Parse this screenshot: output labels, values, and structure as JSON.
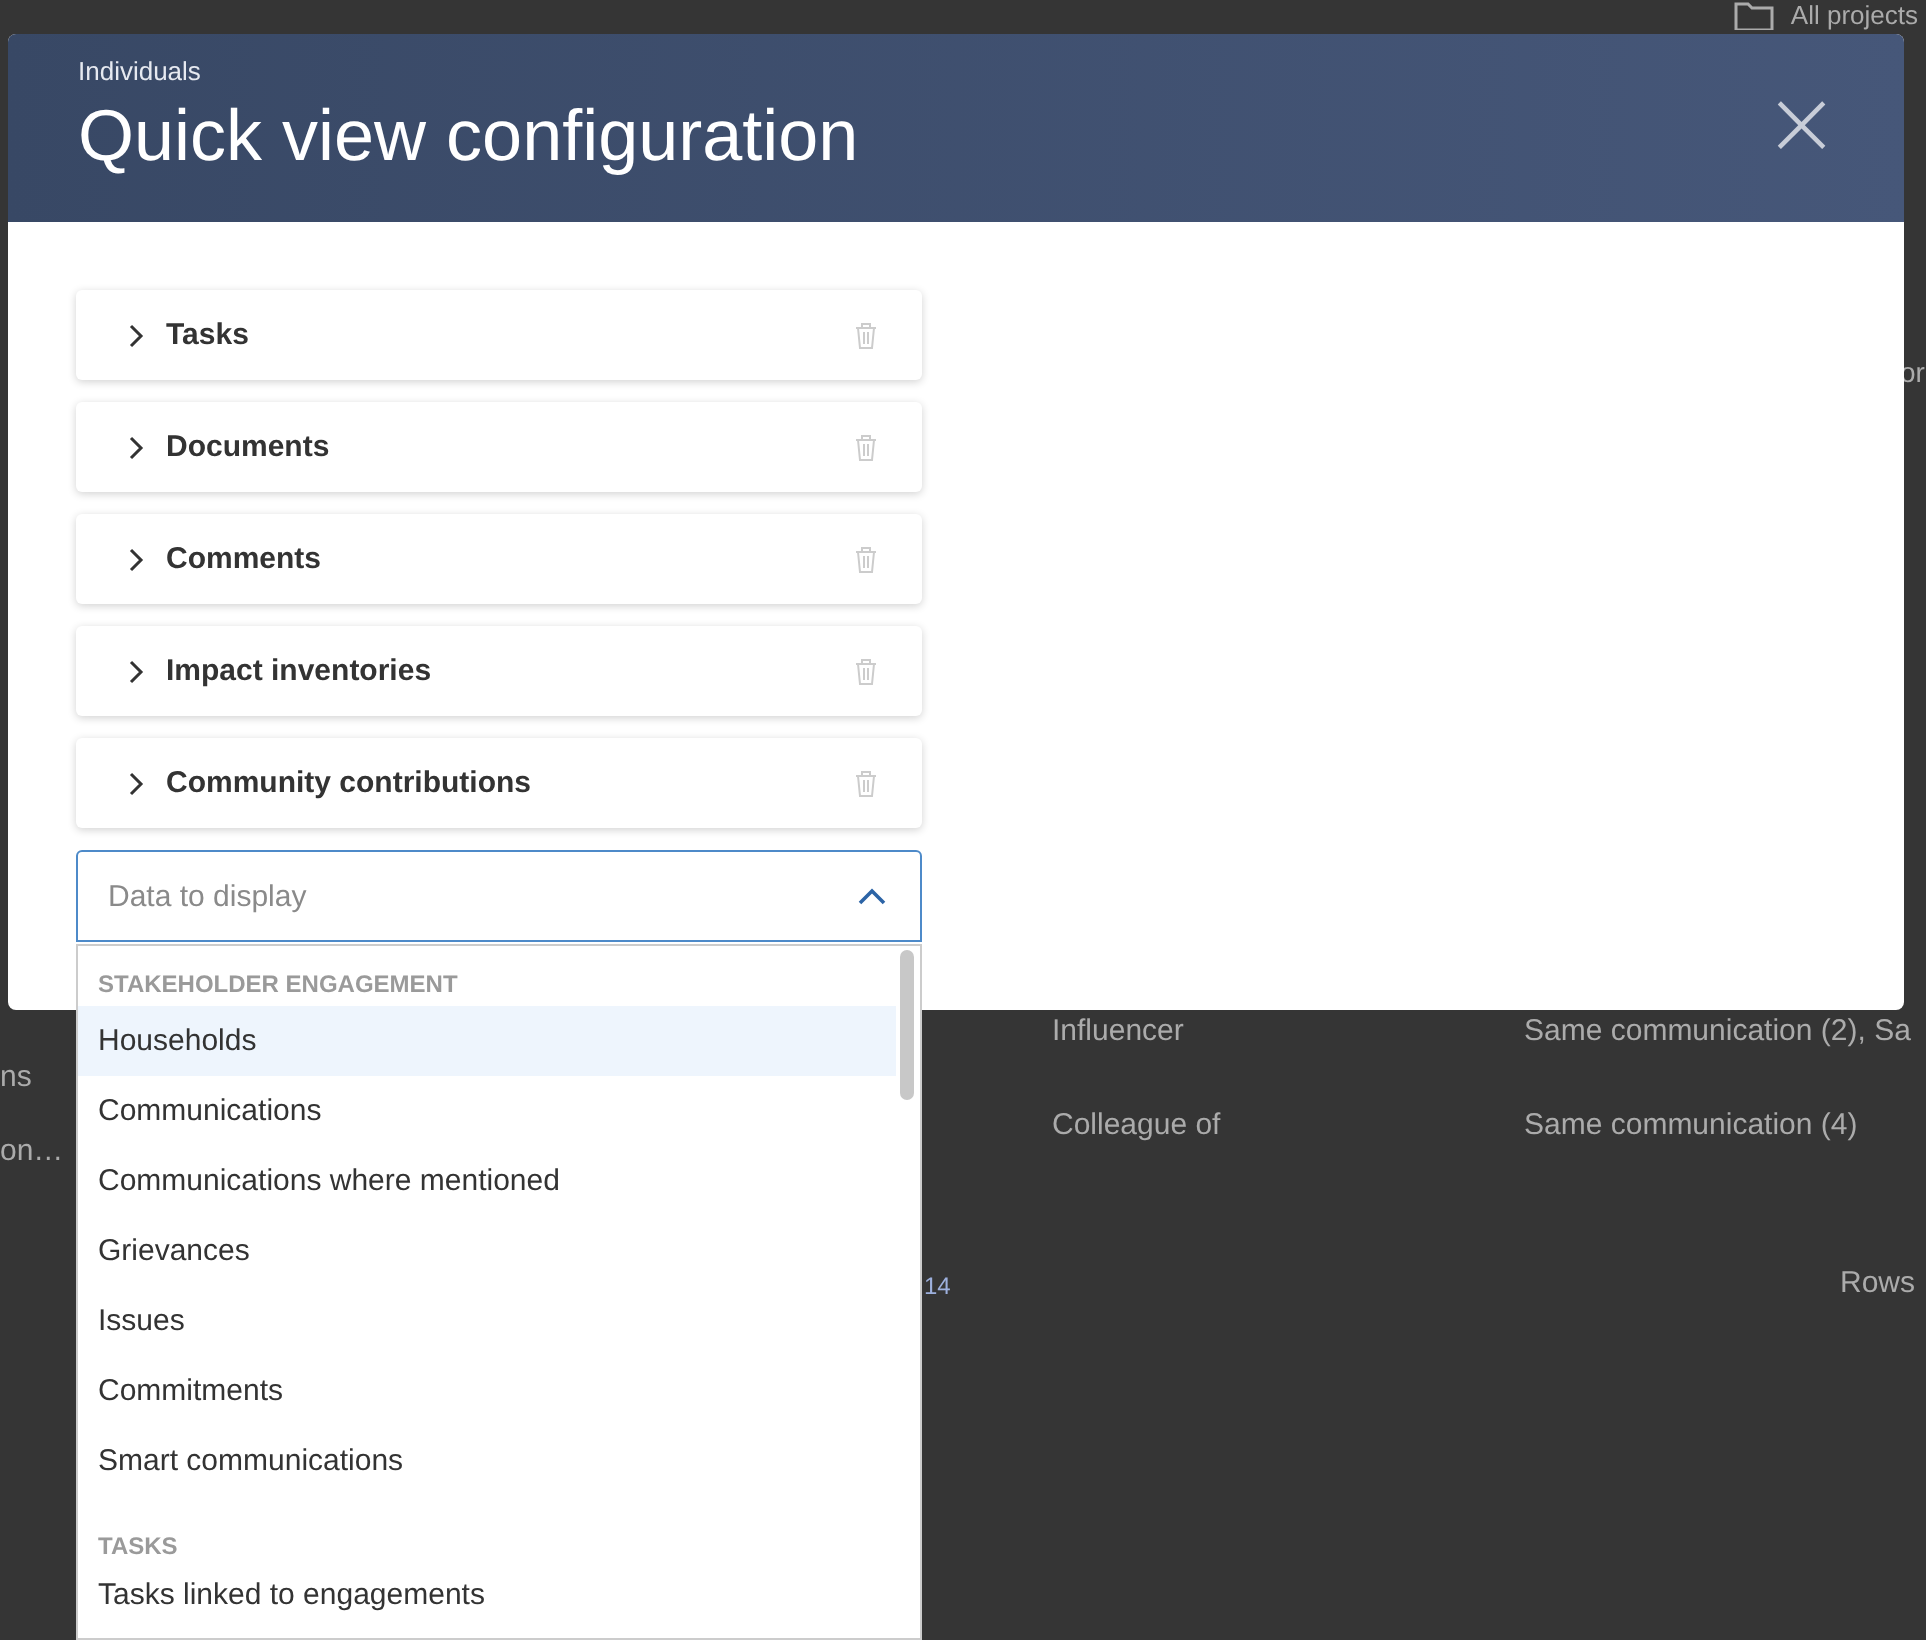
{
  "background": {
    "breadcrumb": "All projects",
    "column_fragment": "or",
    "rows": [
      {
        "cell_1": "ns",
        "cell_2": "Influencer",
        "cell_3": "Same communication (2), Sa"
      },
      {
        "cell_1": "on…",
        "cell_2": "Colleague of",
        "cell_3": "Same communication (4)"
      }
    ],
    "pager_fragment": "14",
    "rows_label": "Rows"
  },
  "dialog": {
    "subtitle": "Individuals",
    "title": "Quick view configuration",
    "close": "×",
    "sections": [
      {
        "label": "Tasks",
        "expanded": false
      },
      {
        "label": "Documents",
        "expanded": false
      },
      {
        "label": "Comments",
        "expanded": false
      },
      {
        "label": "Impact inventories",
        "expanded": false
      },
      {
        "label": "Community contributions",
        "expanded": false
      }
    ],
    "select": {
      "placeholder": "Data to display",
      "expanded": true
    }
  },
  "dropdown": {
    "groups": [
      {
        "heading": "STAKEHOLDER ENGAGEMENT",
        "items": [
          {
            "label": "Households",
            "selected": true
          },
          {
            "label": "Communications",
            "selected": false
          },
          {
            "label": "Communications where mentioned",
            "selected": false
          },
          {
            "label": "Grievances",
            "selected": false
          },
          {
            "label": "Issues",
            "selected": false
          },
          {
            "label": "Commitments",
            "selected": false
          },
          {
            "label": "Smart communications",
            "selected": false
          }
        ]
      },
      {
        "heading": "TASKS",
        "items": [
          {
            "label": "Tasks linked to engagements",
            "selected": false
          }
        ]
      }
    ]
  }
}
